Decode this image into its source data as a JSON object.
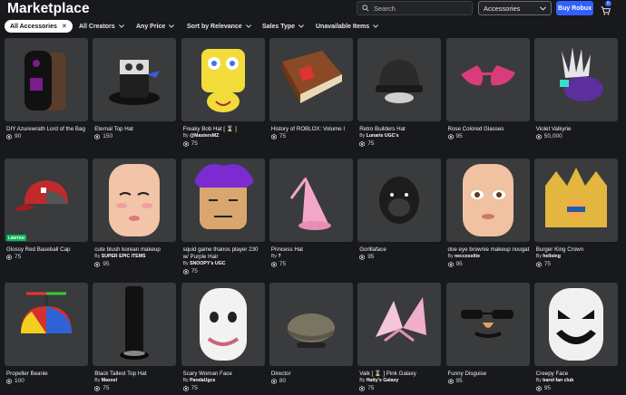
{
  "header": {
    "title": "Marketplace",
    "search_placeholder": "Search",
    "category": "Accessories",
    "buy_label": "Buy Robux",
    "cart_count": "0"
  },
  "filters": [
    {
      "label": "All Accessories",
      "active": true
    },
    {
      "label": "All Creators"
    },
    {
      "label": "Any Price"
    },
    {
      "label": "Sort by Relevance"
    },
    {
      "label": "Sales Type"
    },
    {
      "label": "Unavailable Items"
    }
  ],
  "items": [
    {
      "name": "DIY Azurewrath Lord of the Bag",
      "price": "90",
      "thumb": "bag"
    },
    {
      "name": "Eternal Top Hat",
      "price": "150",
      "thumb": "tophat"
    },
    {
      "name": "Freaky Bob Hat [ ⌛ ]",
      "creator": "@MastersMZ",
      "price": "75",
      "thumb": "bob"
    },
    {
      "name": "History of ROBLOX: Volume I",
      "price": "75",
      "thumb": "book"
    },
    {
      "name": "Retro Builders Hat",
      "creator": "Lunaris UGC's",
      "price": "75",
      "thumb": "hardhat"
    },
    {
      "name": "Rose Colored Glasses",
      "price": "95",
      "thumb": "glasses"
    },
    {
      "name": "Violet Valkyrie",
      "price": "50,000",
      "thumb": "valkyrie"
    },
    {
      "name": "Glossy Red Baseball Cap",
      "price": "75",
      "thumb": "cap",
      "limited": "LIMITED"
    },
    {
      "name": "cute blush korean makeup",
      "creator": "SUPER EPIC ITEMS",
      "price": "95",
      "thumb": "face1"
    },
    {
      "name": "squid game thanos player 230 w/ Purple Hair",
      "creator": "SNOOPY's UGC",
      "price": "75",
      "thumb": "thanos"
    },
    {
      "name": "Princess Hat",
      "creator": "? ",
      "price": "75",
      "thumb": "princess"
    },
    {
      "name": "Gorillaface",
      "price": "95",
      "thumb": "gorilla"
    },
    {
      "name": "doe eye brownie makeup nougat",
      "creator": "neccessitie",
      "price": "95",
      "thumb": "face2"
    },
    {
      "name": "Burger King Crown",
      "creator": "hellsing",
      "price": "75",
      "thumb": "crown"
    },
    {
      "name": "Propeller Beanie",
      "price": "100",
      "thumb": "beanie"
    },
    {
      "name": "Black Tallest Top Hat",
      "creator": "Maxxel",
      "price": "75",
      "thumb": "tallhat"
    },
    {
      "name": "Scary Woman Face",
      "creator": "PandaUgcs",
      "price": "75",
      "thumb": "scary"
    },
    {
      "name": "Director",
      "price": "80",
      "thumb": "director"
    },
    {
      "name": "Valk [ ⌛ ] Pink Galaxy",
      "creator": "Hatty's Galaxy",
      "price": "75",
      "thumb": "pinkvalk"
    },
    {
      "name": "Funny Disguise",
      "price": "95",
      "thumb": "disguise"
    },
    {
      "name": "Creepy Face",
      "creator": "barol fan club",
      "price": "95",
      "thumb": "creepy"
    }
  ]
}
